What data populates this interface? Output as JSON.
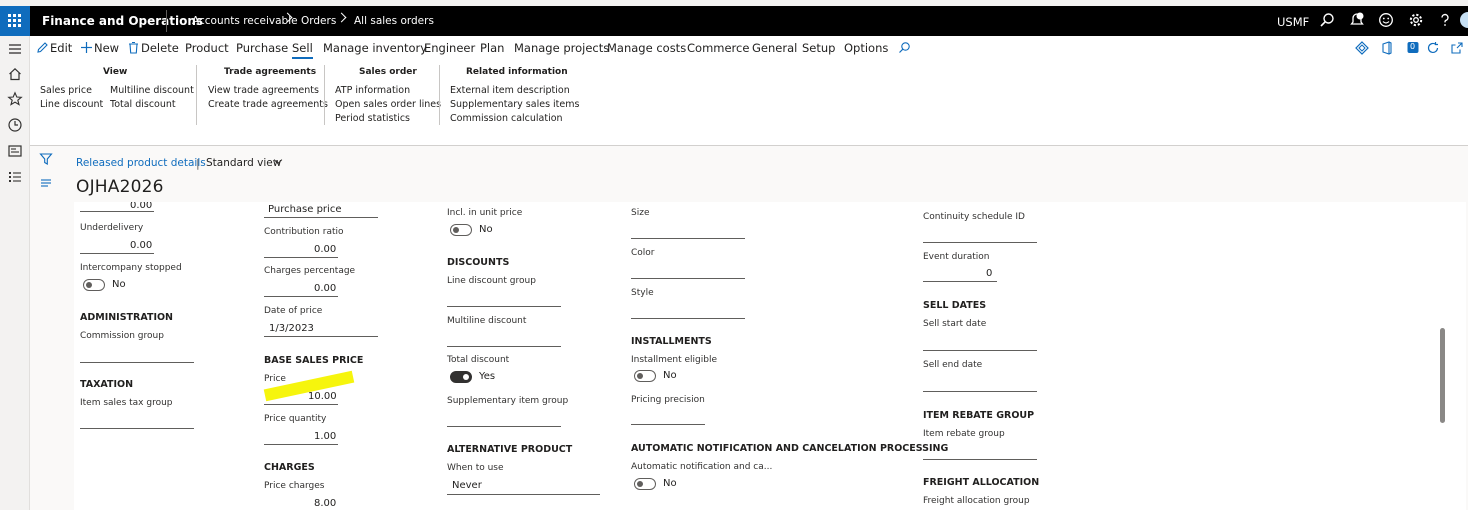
{
  "topbar": {
    "app_title": "Finance and Operations",
    "breadcrumb": [
      "Accounts receivable",
      "Orders",
      "All sales orders"
    ],
    "company": "USMF",
    "icons": [
      "search-icon",
      "notification-icon",
      "feedback-icon",
      "settings-icon",
      "help-icon",
      "avatar"
    ]
  },
  "rail": {
    "icons": [
      "menu-icon",
      "home-icon",
      "favorites-star-icon",
      "recent-clock-icon",
      "workspaces-icon",
      "modules-list-icon"
    ]
  },
  "actionpane": {
    "edit": "Edit",
    "new": "New",
    "delete": "Delete",
    "tabs": [
      "Product",
      "Purchase",
      "Sell",
      "Manage inventory",
      "Engineer",
      "Plan",
      "Manage projects",
      "Manage costs",
      "Commerce",
      "General",
      "Setup",
      "Options"
    ],
    "selected_tab": "Sell",
    "groups": {
      "view": {
        "label": "View",
        "items": [
          "Sales price",
          "Line discount",
          "Multiline discount",
          "Total discount"
        ]
      },
      "trade": {
        "label": "Trade agreements",
        "items": [
          "View trade agreements",
          "Create trade agreements"
        ]
      },
      "salesorder": {
        "label": "Sales order",
        "items": [
          "ATP information",
          "Open sales order lines",
          "Period statistics"
        ]
      },
      "related": {
        "label": "Related information",
        "items": [
          "External item description",
          "Supplementary sales items",
          "Commission calculation"
        ]
      }
    },
    "notification_badge": "0"
  },
  "caption": {
    "link": "Released product details",
    "separator": "|",
    "view": "Standard view",
    "record": "OJHA2026"
  },
  "form": {
    "col1": {
      "top_value": "0.00",
      "underdelivery_label": "Underdelivery",
      "underdelivery_value": "0.00",
      "intercompany_label": "Intercompany stopped",
      "intercompany_value": "No",
      "admin_head": "ADMINISTRATION",
      "commission_label": "Commission group",
      "tax_head": "TAXATION",
      "itemtax_label": "Item sales tax group"
    },
    "col2": {
      "price_base_value": "Purchase price",
      "contribution_label": "Contribution ratio",
      "contribution_value": "0.00",
      "charges_pct_label": "Charges percentage",
      "charges_pct_value": "0.00",
      "date_label": "Date of price",
      "date_value": "1/3/2023",
      "base_head": "BASE SALES PRICE",
      "price_label": "Price",
      "price_value": "10.00",
      "qty_label": "Price quantity",
      "qty_value": "1.00",
      "charges_head": "CHARGES",
      "price_charges_label": "Price charges",
      "price_charges_value": "8.00"
    },
    "col3": {
      "incl_label": "Incl. in unit price",
      "incl_value": "No",
      "discounts_head": "DISCOUNTS",
      "line_disc_label": "Line discount group",
      "multiline_label": "Multiline discount",
      "total_disc_label": "Total discount",
      "total_disc_value": "Yes",
      "supp_label": "Supplementary item group",
      "alt_head": "ALTERNATIVE PRODUCT",
      "when_label": "When to use",
      "when_value": "Never"
    },
    "col4": {
      "size_label": "Size",
      "color_label": "Color",
      "style_label": "Style",
      "inst_head": "INSTALLMENTS",
      "inst_label": "Installment eligible",
      "inst_value": "No",
      "pricing_label": "Pricing precision",
      "auto_head": "AUTOMATIC NOTIFICATION AND CANCELATION PROCESSING",
      "auto_label": "Automatic notification and ca...",
      "auto_value": "No"
    },
    "col5": {
      "continuity_label": "Continuity schedule ID",
      "event_label": "Event duration",
      "event_value": "0",
      "sell_head": "SELL DATES",
      "start_label": "Sell start date",
      "end_label": "Sell end date",
      "rebate_head": "ITEM REBATE GROUP",
      "rebate_label": "Item rebate group",
      "freight_head": "FREIGHT ALLOCATION",
      "freight_label": "Freight allocation group"
    }
  },
  "colors": {
    "accent": "#0f6cbd",
    "topbar": "#000000",
    "highlight": "#f6f400"
  }
}
